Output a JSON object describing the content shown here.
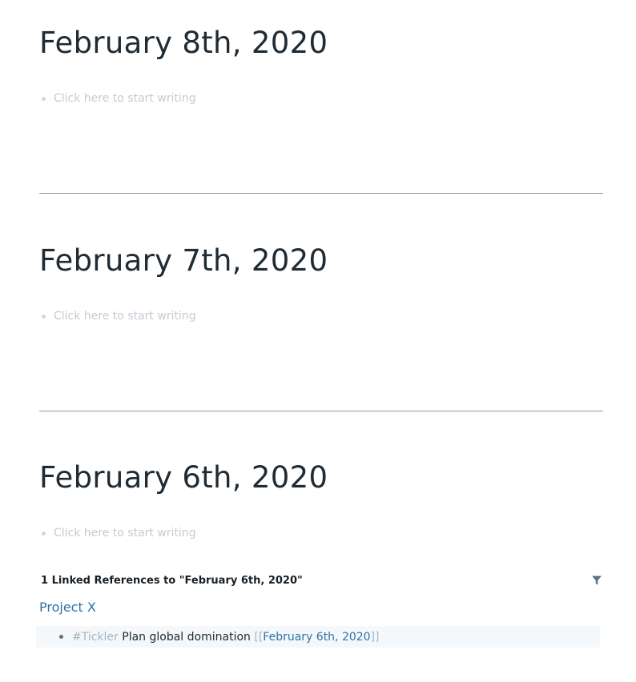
{
  "days": [
    {
      "title": "February 8th, 2020",
      "placeholder": "Click here to start writing"
    },
    {
      "title": "February 7th, 2020",
      "placeholder": "Click here to start writing"
    },
    {
      "title": "February 6th, 2020",
      "placeholder": "Click here to start writing"
    }
  ],
  "linked_references": {
    "title": "1 Linked References to \"February 6th, 2020\"",
    "filter_icon": "filter-icon",
    "groups": [
      {
        "page": "Project X",
        "blocks": [
          {
            "tag": "#Tickler",
            "text": "Plan global domination",
            "bracket_open": "[[",
            "link": "February 6th, 2020",
            "bracket_close": "]]"
          }
        ]
      }
    ]
  },
  "colors": {
    "link": "#2d72a8",
    "placeholder": "#c3ccd3",
    "divider": "#8a9ba8",
    "block_bg": "#f5f8fa"
  }
}
